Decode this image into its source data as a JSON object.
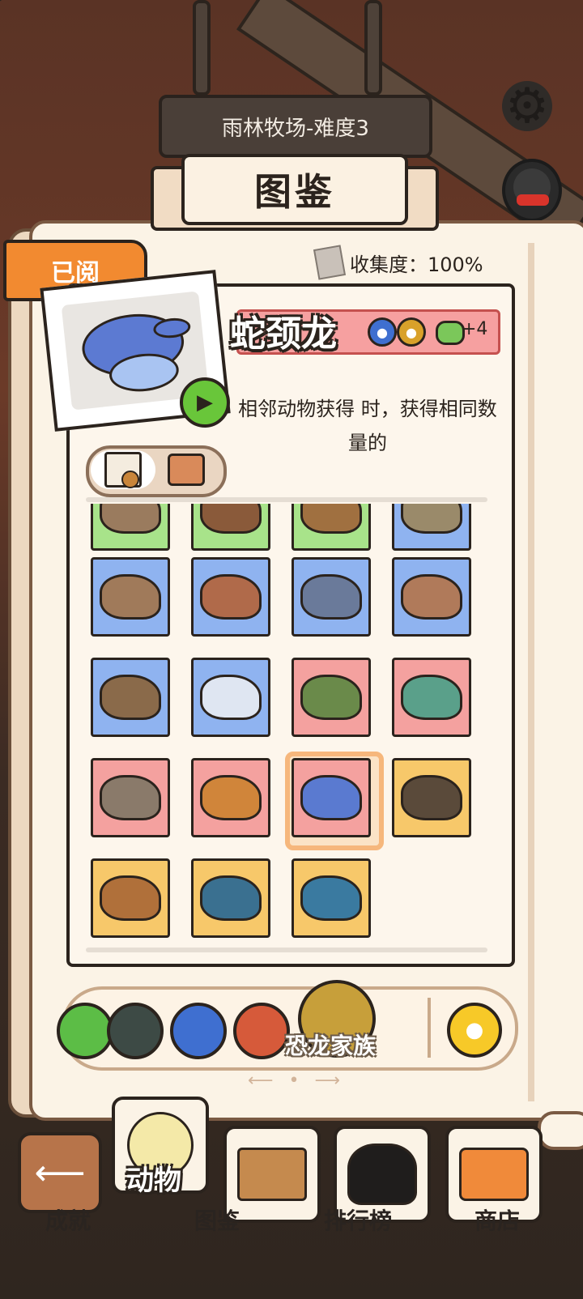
{
  "stage": {
    "title": "雨林牧场-难度3"
  },
  "header": {
    "title": "图鉴"
  },
  "book": {
    "read_tab": "已阅",
    "collection_label": "收集度：100%"
  },
  "animal": {
    "name": "蛇颈龙",
    "bonus": "+4",
    "description": "相邻动物获得  时，获得相同数量的",
    "colors": {
      "name_bar": "#f6a0a0"
    }
  },
  "families": {
    "selected_label": "恐龙家族"
  },
  "nav": {
    "items": [
      {
        "label": "成就",
        "icon": "back-arrow-icon"
      },
      {
        "label": "动物",
        "icon": "chick-icon"
      },
      {
        "label": "图鉴",
        "icon": "basket-icon"
      },
      {
        "label": "排行榜",
        "icon": "cat-icon"
      },
      {
        "label": "商店",
        "icon": "shirt-icon"
      }
    ]
  },
  "tiles": [
    {
      "color": "#a8e38a",
      "mon": "#9a7b5e"
    },
    {
      "color": "#a8e38a",
      "mon": "#8a5a3a"
    },
    {
      "color": "#a8e38a",
      "mon": "#a07040"
    },
    {
      "color": "#8fb3f0",
      "mon": "#9a8a6a"
    },
    {
      "color": "#8fb3f0",
      "mon": "#a07a5a"
    },
    {
      "color": "#8fb3f0",
      "mon": "#b06a4a"
    },
    {
      "color": "#8fb3f0",
      "mon": "#6a7a9a"
    },
    {
      "color": "#8fb3f0",
      "mon": "#b07a5a"
    },
    {
      "color": "#8fb3f0",
      "mon": "#8a6a4a"
    },
    {
      "color": "#8fb3f0",
      "mon": "#dfe6f2"
    },
    {
      "color": "#f4a19f",
      "mon": "#6a8a4a"
    },
    {
      "color": "#f4a19f",
      "mon": "#5aa08a"
    },
    {
      "color": "#f4a19f",
      "mon": "#8a7a6a"
    },
    {
      "color": "#f4a19f",
      "mon": "#d0853a"
    },
    {
      "color": "#f4a19f",
      "mon": "#5a7ad0"
    },
    {
      "color": "#f7c86a",
      "mon": "#5a4a3a"
    },
    {
      "color": "#f7c86a",
      "mon": "#b0703a"
    },
    {
      "color": "#f7c86a",
      "mon": "#3a7090"
    },
    {
      "color": "#f7c86a",
      "mon": "#3a7aa0"
    }
  ]
}
